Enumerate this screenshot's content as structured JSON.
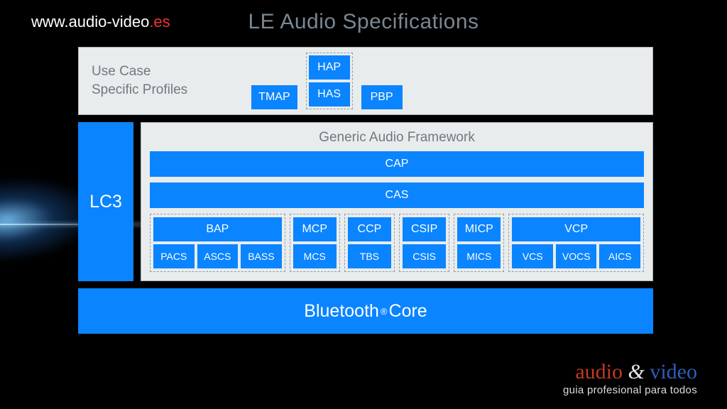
{
  "title": "LE Audio Specifications",
  "url_parts": {
    "prefix": "www.",
    "mid": "audio-video",
    "suffix": ".es"
  },
  "usecase": {
    "label_line1": "Use Case",
    "label_line2": "Specific Profiles",
    "tmap": "TMAP",
    "hap": "HAP",
    "has": "HAS",
    "pbp": "PBP"
  },
  "lc3": "LC3",
  "gaf": {
    "title": "Generic Audio Framework",
    "cap": "CAP",
    "cas": "CAS",
    "groups": {
      "bap": {
        "top": "BAP",
        "bottom": [
          "PACS",
          "ASCS",
          "BASS"
        ]
      },
      "mcp": {
        "top": "MCP",
        "bottom": [
          "MCS"
        ]
      },
      "ccp": {
        "top": "CCP",
        "bottom": [
          "TBS"
        ]
      },
      "csip": {
        "top": "CSIP",
        "bottom": [
          "CSIS"
        ]
      },
      "micp": {
        "top": "MICP",
        "bottom": [
          "MICS"
        ]
      },
      "vcp": {
        "top": "VCP",
        "bottom": [
          "VCS",
          "VOCS",
          "AICS"
        ]
      }
    }
  },
  "core_prefix": "Bluetooth",
  "core_suffix": " Core",
  "brand": {
    "audio": "audio",
    "amp": " & ",
    "video": "video",
    "tagline": "guia profesional para todos"
  }
}
